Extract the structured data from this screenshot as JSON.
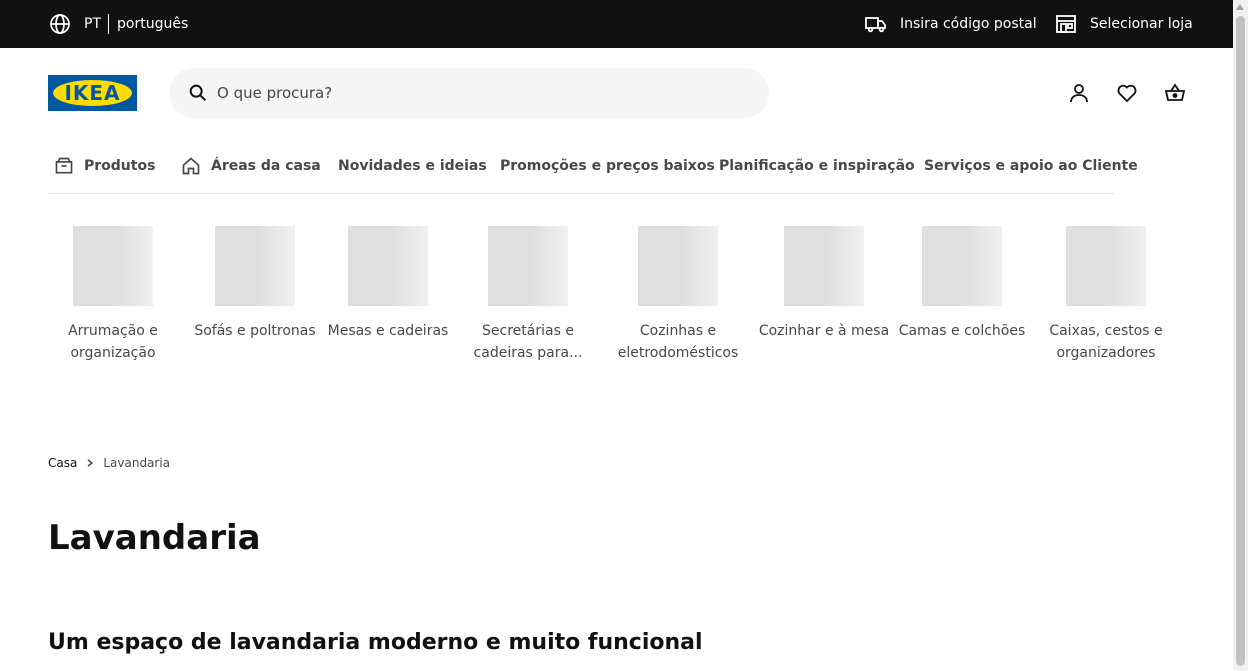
{
  "topbar": {
    "language_code": "PT",
    "language_name": "português",
    "postal_label": "Insira código postal",
    "store_label": "Selecionar loja",
    "icons": [
      "globe-icon",
      "delivery-truck-icon",
      "store-icon"
    ]
  },
  "header": {
    "logo_text": "IKEA",
    "search_placeholder": "O que procura?",
    "icons": [
      "search-icon",
      "user-icon",
      "heart-icon",
      "shopping-bag-icon"
    ]
  },
  "colors": {
    "topbar_bg": "#111111",
    "brand_blue": "#0058a3",
    "brand_yellow": "#ffdb00",
    "search_bg": "#f5f5f5"
  },
  "nav": {
    "items": [
      {
        "label": "Produtos",
        "icon": "box-icon"
      },
      {
        "label": "Áreas da casa",
        "icon": "house-icon"
      },
      {
        "label": "Novidades e ideias"
      },
      {
        "label": "Promoções e preços baixos"
      },
      {
        "label": "Planificação e inspiração"
      },
      {
        "label": "Serviços e apoio ao Cliente"
      }
    ]
  },
  "categories": [
    {
      "label": "Arrumação e organização"
    },
    {
      "label": "Sofás e poltronas"
    },
    {
      "label": "Mesas e cadeiras"
    },
    {
      "label": "Secretárias e cadeiras para..."
    },
    {
      "label": "Cozinhas e eletrodomésticos"
    },
    {
      "label": "Cozinhar e à mesa"
    },
    {
      "label": "Camas e colchões"
    },
    {
      "label": "Caixas, cestos e organizadores"
    }
  ],
  "breadcrumb": {
    "items": [
      "Casa",
      "Lavandaria"
    ]
  },
  "page": {
    "title": "Lavandaria",
    "subtitle": "Um espaço de lavandaria moderno e muito funcional"
  }
}
